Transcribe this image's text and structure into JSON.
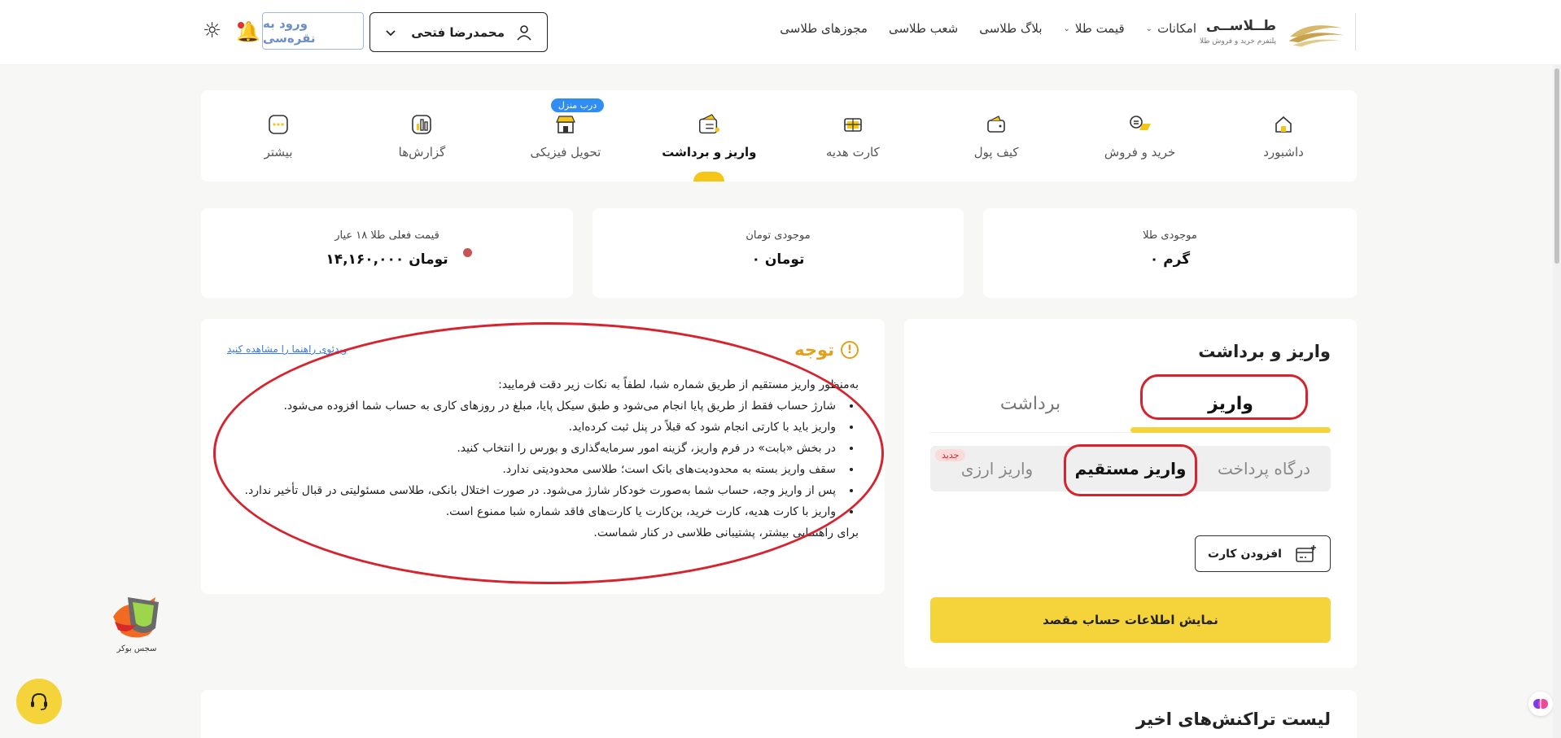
{
  "header": {
    "logo_name": "طــلاســی",
    "logo_tagline": "پلتفرم خرید و فروش طلا",
    "nav": [
      {
        "label": "امکانات",
        "has_dropdown": true
      },
      {
        "label": "قیمت طلا",
        "has_dropdown": true
      },
      {
        "label": "بلاگ طلاسی",
        "has_dropdown": false
      },
      {
        "label": "شعب طلاسی",
        "has_dropdown": false
      },
      {
        "label": "مجوزهای طلاسی",
        "has_dropdown": false
      }
    ],
    "user_name": "محمدرضا فتحی",
    "silver_login": "ورود به نقره‌سی",
    "icons": {
      "user": "user-icon",
      "chevron": "chevron-down-icon",
      "bell": "bell-icon",
      "theme": "sun-icon"
    }
  },
  "main_nav": {
    "tabs": [
      {
        "label": "داشبورد",
        "icon": "home-icon"
      },
      {
        "label": "خرید و فروش",
        "icon": "exchange-icon"
      },
      {
        "label": "کیف پول",
        "icon": "wallet-icon"
      },
      {
        "label": "کارت هدیه",
        "icon": "gift-card-icon"
      },
      {
        "label": "واریز و برداشت",
        "icon": "deposit-withdraw-icon",
        "active": true
      },
      {
        "label": "تحویل فیزیکی",
        "icon": "store-icon",
        "badge": "درب منزل"
      },
      {
        "label": "گزارش‌ها",
        "icon": "chart-icon"
      },
      {
        "label": "بیشتر",
        "icon": "more-icon"
      }
    ]
  },
  "balances": {
    "gold": {
      "label": "موجودی طلا",
      "value": "۰ گرم"
    },
    "toman": {
      "label": "موجودی تومان",
      "value": "۰ تومان"
    },
    "price": {
      "label": "قیمت فعلی طلا ۱۸ عیار",
      "value": "۱۴,۱۶۰,۰۰۰ تومان"
    }
  },
  "notice": {
    "title": "توجه",
    "video_link": "ویدئوی راهنما را مشاهده کنید",
    "intro": "به‌منظور واریز مستقیم از طریق شماره شبا، لطفاً به نکات زیر دقت فرمایید:",
    "items": [
      "شارژ حساب فقط از طریق پایا انجام می‌شود و طبق سیکل پایا، مبلغ در روزهای کاری به حساب شما افزوده می‌شود.",
      "واریز باید با کارتی انجام شود که قبلاً در پنل ثبت کرده‌اید.",
      "در بخش «بابت» در فرم واریز، گزینه امور سرمایه‌گذاری و بورس را انتخاب کنید.",
      "سقف واریز بسته به محدودیت‌های بانک است؛ طلاسی محدودیتی ندارد.",
      "پس از واریز وجه، حساب شما به‌صورت خودکار شارژ می‌شود. در صورت اختلال بانکی، طلاسی مسئولیتی در قبال تأخیر ندارد.",
      "واریز با کارت هدیه، کارت خرید، بن‌کارت یا کارت‌های فاقد شماره شبا ممنوع است."
    ],
    "footer": "برای راهنمایی بیشتر، پشتیبانی طلاسی در کنار شماست."
  },
  "deposit_withdraw": {
    "title": "واریز و برداشت",
    "tabs": [
      {
        "label": "واریز",
        "active": true
      },
      {
        "label": "برداشت",
        "active": false
      }
    ],
    "methods": [
      {
        "label": "درگاه پرداخت",
        "active": false
      },
      {
        "label": "واریز مستقیم",
        "active": true
      },
      {
        "label": "واریز ارزی",
        "active": false,
        "badge": "جدید"
      }
    ],
    "add_card": "افزودن کارت",
    "show_account": "نمایش اطلاعات حساب مقصد"
  },
  "recent": {
    "title": "لیست تراکنش‌های اخیر"
  },
  "floating": {
    "boker_label": "سجس بوکر"
  },
  "colors": {
    "accent": "#f5d33b",
    "annotation": "#d6232d",
    "warning": "#e3a01a",
    "link": "#3a7bd5",
    "badge_blue": "#2f8df4"
  }
}
